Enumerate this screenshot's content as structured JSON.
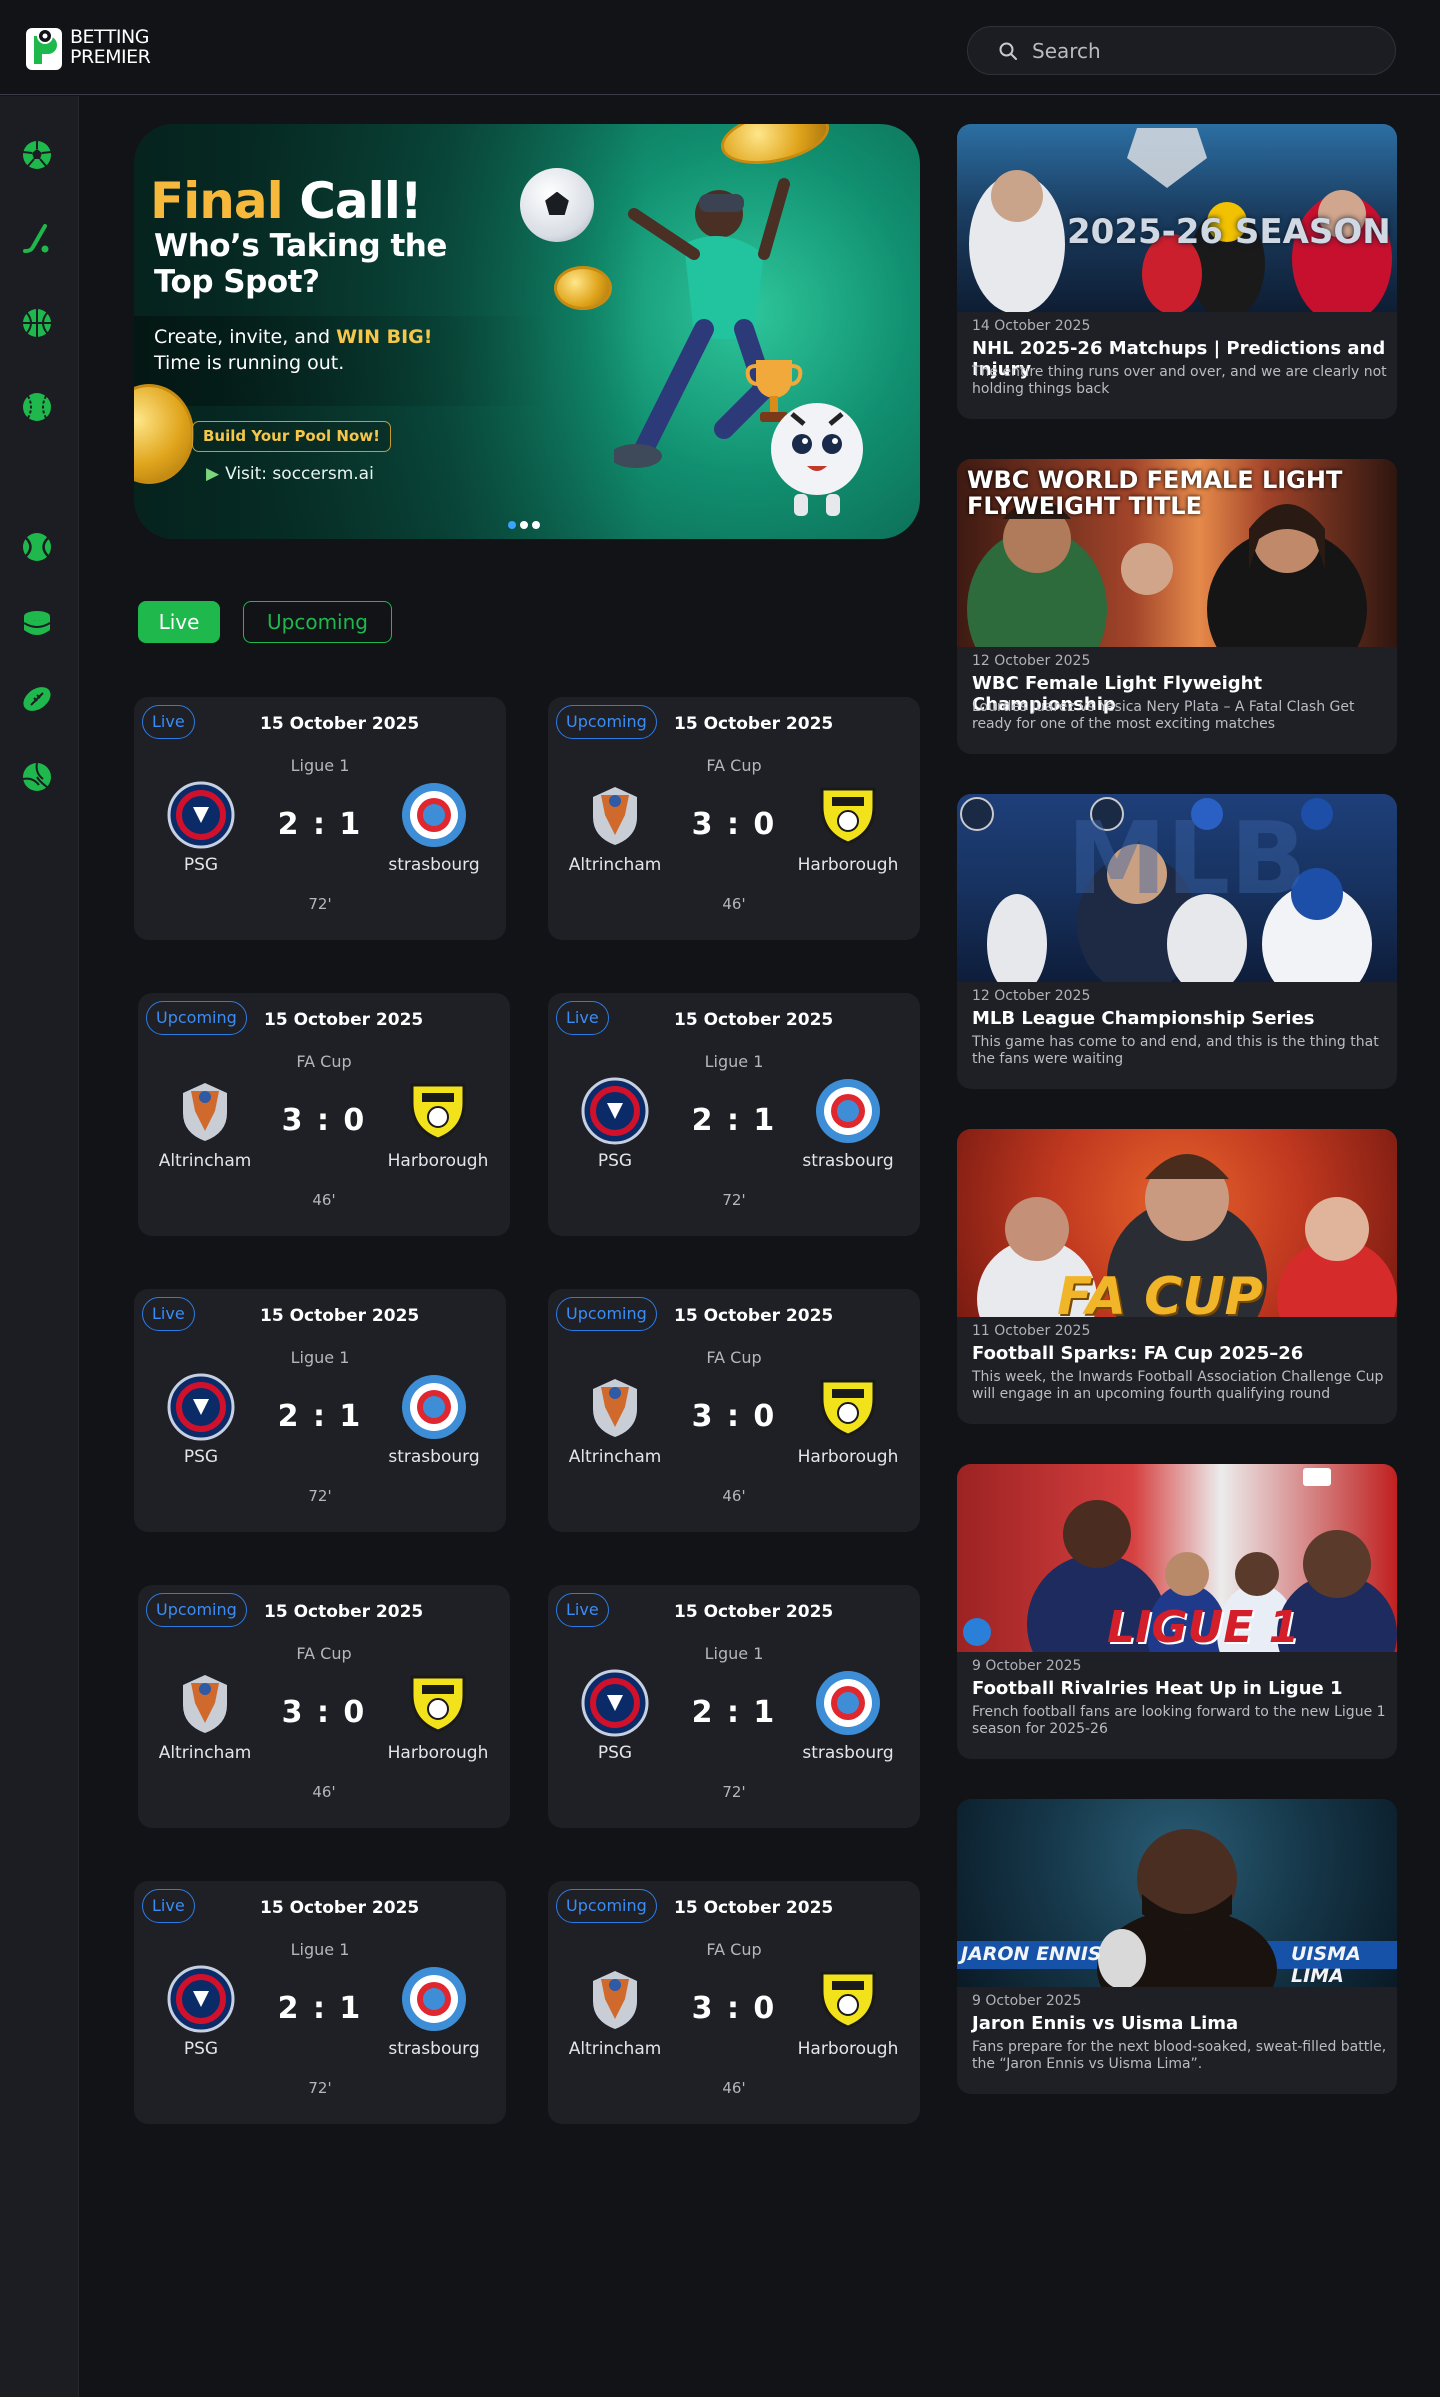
{
  "header": {
    "logo_line1": "BETTING",
    "logo_line2": "PREMIER",
    "search_placeholder": "Search"
  },
  "colors": {
    "accent_green": "#1eb84c",
    "chip_blue": "#2c7be5",
    "gold": "#f6b93b",
    "background": "#121317",
    "card": "#1e2025"
  },
  "sidebar": {
    "items": [
      {
        "icon": "soccer-ball-icon"
      },
      {
        "icon": "hockey-stick-icon"
      },
      {
        "icon": "basketball-icon"
      },
      {
        "icon": "baseball-icon"
      },
      {
        "icon": "tennis-ball-icon"
      },
      {
        "icon": "database-icon"
      },
      {
        "icon": "american-football-icon"
      },
      {
        "icon": "volleyball-icon"
      }
    ]
  },
  "banner": {
    "title_word1": "Final",
    "title_word2": "Call!",
    "subtitle": "Who’s Taking the Top Spot?",
    "desc_prefix": "Create, invite, and",
    "desc_highlight": "WIN BIG!",
    "desc_line2": "Time is running out.",
    "button_label": "Build Your Pool Now!",
    "visit_text": "Visit: soccersm.ai",
    "slides_count": 3,
    "active_slide": 1
  },
  "tabs": {
    "live_label": "Live",
    "upcoming_label": "Upcoming"
  },
  "matches": [
    {
      "status": "Live",
      "date": "15 October 2025",
      "league": "Ligue 1",
      "home": "PSG",
      "away": "strasbourg",
      "score": "2 : 1",
      "minute": "72'"
    },
    {
      "status": "Upcoming",
      "date": "15 October 2025",
      "league": "FA Cup",
      "home": "Altrincham",
      "away": "Harborough",
      "score": "3 : 0",
      "minute": "46'"
    },
    {
      "status": "Upcoming",
      "date": "15 October 2025",
      "league": "FA Cup",
      "home": "Altrincham",
      "away": "Harborough",
      "score": "3 : 0",
      "minute": "46'"
    },
    {
      "status": "Live",
      "date": "15 October 2025",
      "league": "Ligue 1",
      "home": "PSG",
      "away": "strasbourg",
      "score": "2 : 1",
      "minute": "72'"
    },
    {
      "status": "Live",
      "date": "15 October 2025",
      "league": "Ligue 1",
      "home": "PSG",
      "away": "strasbourg",
      "score": "2 : 1",
      "minute": "72'"
    },
    {
      "status": "Upcoming",
      "date": "15 October 2025",
      "league": "FA Cup",
      "home": "Altrincham",
      "away": "Harborough",
      "score": "3 : 0",
      "minute": "46'"
    },
    {
      "status": "Upcoming",
      "date": "15 October 2025",
      "league": "FA Cup",
      "home": "Altrincham",
      "away": "Harborough",
      "score": "3 : 0",
      "minute": "46'"
    },
    {
      "status": "Live",
      "date": "15 October 2025",
      "league": "Ligue 1",
      "home": "PSG",
      "away": "strasbourg",
      "score": "2 : 1",
      "minute": "72'"
    },
    {
      "status": "Live",
      "date": "15 October 2025",
      "league": "Ligue 1",
      "home": "PSG",
      "away": "strasbourg",
      "score": "2 : 1",
      "minute": "72'"
    },
    {
      "status": "Upcoming",
      "date": "15 October 2025",
      "league": "FA Cup",
      "home": "Altrincham",
      "away": "Harborough",
      "score": "3 : 0",
      "minute": "46'"
    }
  ],
  "news": [
    {
      "date": "14 October 2025",
      "title": "NHL 2025-26 Matchups | Predictions and Injury",
      "desc": "The entire thing runs over and over, and we are clearly not holding things back",
      "image_text": "2025-26 SEASON"
    },
    {
      "date": "12 October 2025",
      "title": "WBC Female Light Flyweight Championship",
      "desc": "Lourdes Juarez vs Yesica Nery Plata – A Fatal Clash Get ready for one of the most exciting matches",
      "image_text": "WBC WORLD FEMALE LIGHT FLYWEIGHT TITLE"
    },
    {
      "date": "12 October 2025",
      "title": "MLB League Championship Series",
      "desc": "This game has come to and end, and this is the thing that the fans were waiting",
      "image_text": "MLB"
    },
    {
      "date": "11 October 2025",
      "title": "Football Sparks: FA Cup 2025–26",
      "desc": "This week, the Inwards Football Association Challenge Cup will engage in an upcoming fourth qualifying round",
      "image_text": "FA CUP"
    },
    {
      "date": "9 October 2025",
      "title": "Football Rivalries Heat Up in Ligue 1",
      "desc": "French football fans are looking forward to the new Ligue 1 season for 2025-26",
      "image_text": "LIGUE 1"
    },
    {
      "date": "9 October 2025",
      "title": "Jaron Ennis vs Uisma Lima",
      "desc": "Fans prepare for the next blood-soaked, sweat-filled battle, the “Jaron Ennis vs Uisma Lima”.",
      "image_text_left": "JARON ENNIS",
      "image_text_right": "UISMA LIMA"
    }
  ]
}
